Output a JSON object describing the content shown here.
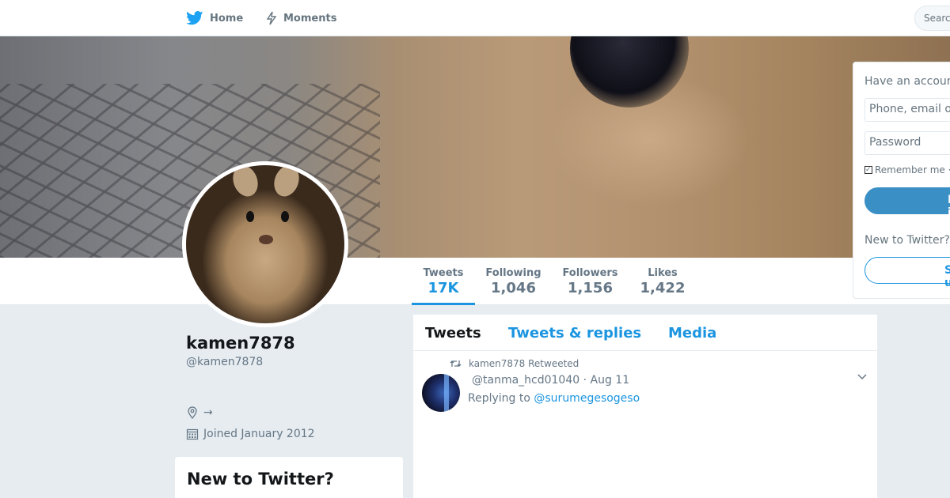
{
  "nav": {
    "home_label": "Home",
    "moments_label": "Moments",
    "search_placeholder": "Search"
  },
  "profile": {
    "name": "kamen7878",
    "handle": "@kamen7878",
    "location": "→",
    "joined": "Joined January 2012"
  },
  "stats": [
    {
      "label": "Tweets",
      "value": "17K"
    },
    {
      "label": "Following",
      "value": "1,046"
    },
    {
      "label": "Followers",
      "value": "1,156"
    },
    {
      "label": "Likes",
      "value": "1,422"
    }
  ],
  "timeline": {
    "tabs": [
      "Tweets",
      "Tweets & replies",
      "Media"
    ],
    "tweet": {
      "retweet_note": "kamen7878 Retweeted",
      "meta": "@tanma_hcd01040 · Aug 11",
      "replying_prefix": "Replying to ",
      "replying_to": "@surumegesogeso"
    }
  },
  "new_to_twitter_card": {
    "title": "New to Twitter?"
  },
  "login": {
    "have_account": "Have an account?",
    "username_placeholder": "Phone, email or username",
    "password_placeholder": "Password",
    "remember": "Remember me · Forgot password?",
    "login_button": "Log in",
    "new_to": "New to Twitter?",
    "signup_button": "Sign up"
  },
  "colors": {
    "brand_blue": "#1b95e0",
    "twitter_bird": "#1da1f2",
    "background": "#e6ecf0"
  }
}
